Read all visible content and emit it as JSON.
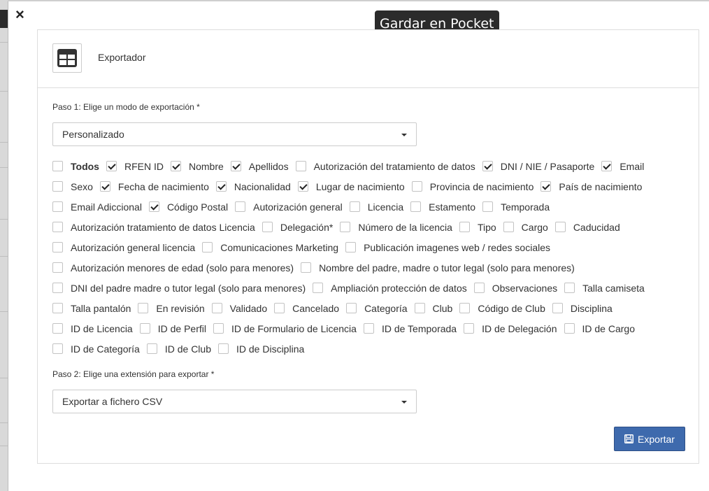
{
  "tooltip": "Gardar en Pocket",
  "close_symbol": "×",
  "header": {
    "title": "Exportador",
    "icon": "table-icon"
  },
  "step1": {
    "label": "Paso 1: Elige un modo de exportación *",
    "selected": "Personalizado"
  },
  "step2": {
    "label": "Paso 2: Elige una extensión para exportar *",
    "selected": "Exportar a fichero CSV"
  },
  "fields": [
    [
      {
        "label": "Todos",
        "checked": false,
        "bold": true
      },
      {
        "label": "RFEN ID",
        "checked": true
      },
      {
        "label": "Nombre",
        "checked": true
      },
      {
        "label": "Apellidos",
        "checked": true
      },
      {
        "label": "Autorización del tratamiento de datos",
        "checked": false
      },
      {
        "label": "DNI / NIE / Pasaporte",
        "checked": true
      },
      {
        "label": "Email",
        "checked": true
      }
    ],
    [
      {
        "label": "Sexo",
        "checked": false
      },
      {
        "label": "Fecha de nacimiento",
        "checked": true
      },
      {
        "label": "Nacionalidad",
        "checked": true
      },
      {
        "label": "Lugar de nacimiento",
        "checked": true
      },
      {
        "label": "Provincia de nacimiento",
        "checked": false
      },
      {
        "label": "País de nacimiento",
        "checked": true
      }
    ],
    [
      {
        "label": "Email Adiccional",
        "checked": false
      },
      {
        "label": "Código Postal",
        "checked": true
      },
      {
        "label": "Autorización general",
        "checked": false
      },
      {
        "label": "Licencia",
        "checked": false
      },
      {
        "label": "Estamento",
        "checked": false
      },
      {
        "label": "Temporada",
        "checked": false
      }
    ],
    [
      {
        "label": "Autorización tratamiento de datos Licencia",
        "checked": false
      },
      {
        "label": "Delegación*",
        "checked": false
      },
      {
        "label": "Número de la licencia",
        "checked": false
      },
      {
        "label": "Tipo",
        "checked": false
      },
      {
        "label": "Cargo",
        "checked": false
      },
      {
        "label": "Caducidad",
        "checked": false
      }
    ],
    [
      {
        "label": "Autorización general licencia",
        "checked": false
      },
      {
        "label": "Comunicaciones Marketing",
        "checked": false
      },
      {
        "label": "Publicación imagenes web / redes sociales",
        "checked": false
      }
    ],
    [
      {
        "label": "Autorización menores de edad (solo para menores)",
        "checked": false
      },
      {
        "label": "Nombre del padre, madre o tutor legal (solo para menores)",
        "checked": false
      }
    ],
    [
      {
        "label": "DNI del padre madre o tutor legal (solo para menores)",
        "checked": false
      },
      {
        "label": "Ampliación protección de datos",
        "checked": false
      },
      {
        "label": "Observaciones",
        "checked": false
      },
      {
        "label": "Talla camiseta",
        "checked": false
      }
    ],
    [
      {
        "label": "Talla pantalón",
        "checked": false
      },
      {
        "label": "En revisión",
        "checked": false
      },
      {
        "label": "Validado",
        "checked": false
      },
      {
        "label": "Cancelado",
        "checked": false
      },
      {
        "label": "Categoría",
        "checked": false
      },
      {
        "label": "Club",
        "checked": false
      },
      {
        "label": "Código de Club",
        "checked": false
      },
      {
        "label": "Disciplina",
        "checked": false
      }
    ],
    [
      {
        "label": "ID de Licencia",
        "checked": false
      },
      {
        "label": "ID de Perfil",
        "checked": false
      },
      {
        "label": "ID de Formulario de Licencia",
        "checked": false
      },
      {
        "label": "ID de Temporada",
        "checked": false
      },
      {
        "label": "ID de Delegación",
        "checked": false
      },
      {
        "label": "ID de Cargo",
        "checked": false
      }
    ],
    [
      {
        "label": "ID de Categoría",
        "checked": false
      },
      {
        "label": "ID de Club",
        "checked": false
      },
      {
        "label": "ID de Disciplina",
        "checked": false
      }
    ]
  ],
  "export_button": {
    "label": "Exportar",
    "icon": "floppy-disk-icon"
  },
  "colors": {
    "primary": "#3e6aad",
    "tooltip_bg": "#2b2b2b"
  }
}
